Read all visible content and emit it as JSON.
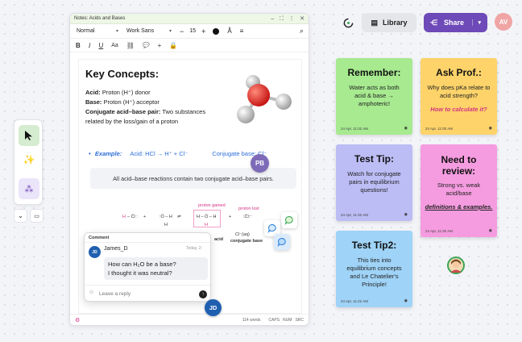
{
  "document": {
    "title": "Notes: Acids and Bases",
    "style_select": "Normal",
    "font_select": "Work Sans",
    "font_size": "15",
    "heading": "Key Concepts:",
    "acid_label": "Acid:",
    "acid_text": "Proton (H⁺) donor",
    "base_label": "Base:",
    "base_text": "Proton (H⁺) acceptor",
    "pair_label": "Conjugate acid–base pair:",
    "pair_text_1": "Two substances",
    "pair_text_2": "related by the loss/gain of a proton",
    "example_label": "Example:",
    "example_text": "Acid: HCl → H⁺ + Cl⁻",
    "example_link": "Conjugate base: Cl⁻",
    "callout": "All acid–base reactions contain two conjugate acid–base pairs.",
    "diagram": {
      "proton_gained": "proton gained",
      "proton_lost": "proton lost",
      "cl_aq": "Cl⁻(aq)",
      "conjugate_base": "conjugate base",
      "acid_fragment": "acid"
    },
    "status": {
      "words": "114 words",
      "caps": "CAPS",
      "num": "NUM",
      "scr": "SRC"
    }
  },
  "comment": {
    "header": "Comment",
    "author": "James_D",
    "author_initials": "JD",
    "time": "Today, 2:",
    "message_1": "How can H₂O be a base?",
    "message_2": "I thought it was neutral?",
    "reply_placeholder": "Leave a reply"
  },
  "avatars": {
    "pb": "PB",
    "jd": "JD",
    "av": "AV"
  },
  "topbar": {
    "library": "Library",
    "share": "Share"
  },
  "stickies": [
    {
      "title": "Remember:",
      "body_1": "Water acts as both",
      "body_2": "acid & base →",
      "body_3": "amphoteric!",
      "date": "24 Apr, 11:02 AM",
      "color": "#a7ea90"
    },
    {
      "title": "Ask Prof.:",
      "body_1": "Why does pKa relate to",
      "body_2": "acid strength?",
      "link": "How to calculate it?",
      "date": "24 Apr, 11:00 AM",
      "color": "#fdd36a"
    },
    {
      "title": "Test Tip:",
      "body_1": "Watch for conjugate",
      "body_2": "pairs in equilibrium",
      "body_3": "questions!",
      "date": "24 Apr, 11:32 AM",
      "color": "#bcbdf5"
    },
    {
      "title_1": "Need to",
      "title_2": "review:",
      "body_1": "Strong vs. weak",
      "body_2": "acid/base",
      "link": "definitions & examples.",
      "date": "24 Apr, 11:30 AM",
      "color": "#f59ce0"
    },
    {
      "title": "Test Tip2:",
      "body_1": "This ties into",
      "body_2": "equilibrium concepts",
      "body_3": "and Le Chatelier's",
      "body_4": "Principle!",
      "date": "24 Apr, 11:22 AM",
      "color": "#9fd3f7"
    }
  ],
  "colors": {
    "accent_purple": "#6e4ab8",
    "link_blue": "#2e6fd8",
    "link_pink": "#d63384"
  }
}
